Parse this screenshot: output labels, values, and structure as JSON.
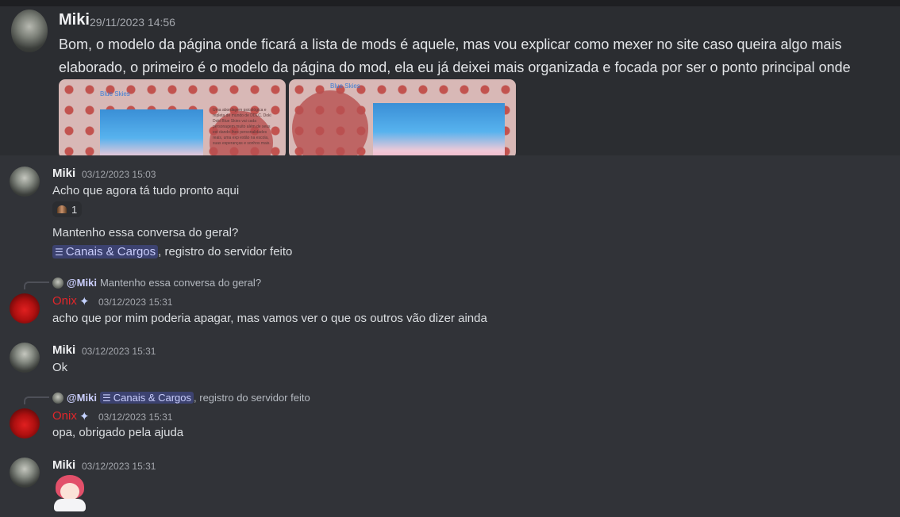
{
  "top_message": {
    "author": "Miki",
    "timestamp": "29/11/2023 14:56",
    "text": "Bom, o modelo da página onde ficará a lista de mods é aquele, mas vou explicar como mexer no site caso queira algo mais elaborado, o primeiro é o modelo da página do mod, ela eu já deixei mais organizada e focada por ser o ponto principal onde alguém vai ver sobre o mod",
    "images": [
      {
        "site_title": "Blue Skies",
        "side_text": "Uma abordagem psicológica e repleta de mundo de DDLC. Doki Doki Blue Skies vai cada personagem muito além de seus est dando-lhes personalidades reais, uma exp estão na escola, suas esperanças e sonhos mais."
      },
      {
        "site_title": "Blue Skies"
      }
    ]
  },
  "messages": [
    {
      "author": "Miki",
      "timestamp": "03/12/2023 15:03",
      "lines": [
        "Acho que agora tá tudo pronto aqui",
        "Mantenho essa conversa do geral?"
      ],
      "reaction_count": "1",
      "mention_channel": "Canais & Cargos",
      "mention_suffix": ", registro do servidor feito"
    },
    {
      "reply_to": "@Miki",
      "reply_text": "Mantenho essa conversa do geral?",
      "author": "Onix",
      "timestamp": "03/12/2023 15:31",
      "text": "acho que por mim poderia apagar, mas vamos ver o que os outros vão dizer ainda"
    },
    {
      "author": "Miki",
      "timestamp": "03/12/2023 15:31",
      "text": "Ok"
    },
    {
      "reply_to": "@Miki",
      "reply_channel": "Canais & Cargos",
      "reply_suffix": ", registro do servidor feito",
      "author": "Onix",
      "timestamp": "03/12/2023 15:31",
      "text": "opa, obrigado pela ajuda"
    },
    {
      "author": "Miki",
      "timestamp": "03/12/2023 15:31"
    }
  ],
  "icons": {
    "channel": "channel-list-icon",
    "sparkle": "sparkle-icon",
    "reaction": "emoji-reaction-icon"
  },
  "colors": {
    "background": "#313338",
    "top_panel": "#2b2d31",
    "mention_bg": "#3c4270",
    "mention_text": "#c9cdfb",
    "onix_name": "#e0262a"
  }
}
